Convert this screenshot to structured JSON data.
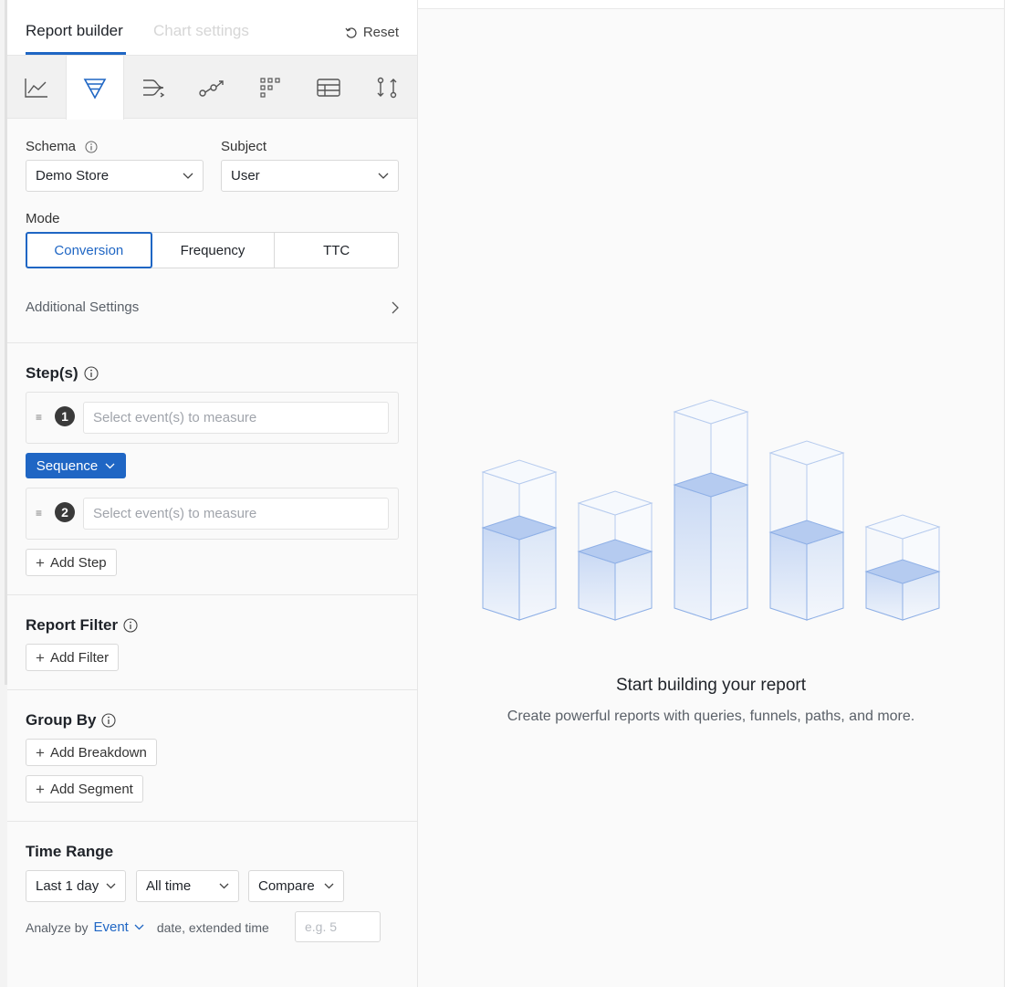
{
  "header": {
    "tab_active": "Report builder",
    "tab_inactive": "Chart settings",
    "reset_label": "Reset"
  },
  "chart_types": [
    {
      "name": "line-chart-icon"
    },
    {
      "name": "funnel-icon",
      "active": true
    },
    {
      "name": "flow-icon"
    },
    {
      "name": "path-icon"
    },
    {
      "name": "grid-icon"
    },
    {
      "name": "table-icon"
    },
    {
      "name": "compare-icon"
    }
  ],
  "schema": {
    "label": "Schema",
    "value": "Demo Store"
  },
  "subject": {
    "label": "Subject",
    "value": "User"
  },
  "mode": {
    "label": "Mode",
    "options": [
      "Conversion",
      "Frequency",
      "TTC"
    ],
    "selected": "Conversion"
  },
  "additional_settings": "Additional Settings",
  "steps": {
    "title": "Step(s)",
    "items": [
      {
        "num": "1",
        "placeholder": "Select event(s) to measure"
      },
      {
        "num": "2",
        "placeholder": "Select event(s) to measure"
      }
    ],
    "sequence_label": "Sequence",
    "add_step": "Add Step"
  },
  "report_filter": {
    "title": "Report Filter",
    "add_filter": "Add Filter"
  },
  "group_by": {
    "title": "Group By",
    "add_breakdown": "Add Breakdown",
    "add_segment": "Add Segment"
  },
  "time_range": {
    "title": "Time Range",
    "range": "Last 1 day",
    "period": "All time",
    "compare": "Compare",
    "analyze_by": "Analyze by",
    "analyze_value": "Event",
    "analyze_rest": "date, extended time",
    "analyze_placeholder": "e.g. 5"
  },
  "empty_state": {
    "title": "Start building your report",
    "subtitle": "Create powerful reports with queries, funnels, paths, and more."
  },
  "colors": {
    "accent": "#1f66c4"
  }
}
